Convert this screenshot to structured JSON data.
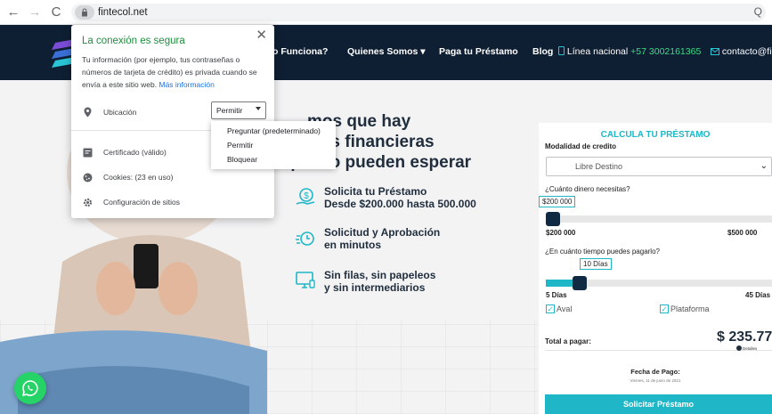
{
  "browser": {
    "url": "fintecol.net",
    "back_glyph": "←",
    "forward_glyph": "→",
    "reload_glyph": "C",
    "end_glyph": "Q"
  },
  "navbar": {
    "items": [
      {
        "label": "o Funciona?"
      },
      {
        "label": "Quienes Somos ▾"
      },
      {
        "label": "Paga tu Préstamo"
      },
      {
        "label": "Blog"
      }
    ],
    "line_label": "Línea nacional",
    "phone": "+57 3002161365",
    "email": "contacto@fi"
  },
  "hero": {
    "headline_line1": "mos que hay",
    "headline_line2": "cias financieras",
    "headline_line3": "que no pueden esperar",
    "features": [
      {
        "icon": "money-request-icon",
        "line1": "Solicita tu Préstamo",
        "line2": "Desde $200.000 hasta 500.000"
      },
      {
        "icon": "stopwatch-icon",
        "line1": "Solicitud y Aprobación",
        "line2": "en minutos"
      },
      {
        "icon": "monitor-icon",
        "line1": "Sin filas, sin papeleos",
        "line2": "y sin intermediarios"
      }
    ]
  },
  "calculator": {
    "title": "CALCULA TU PRÉSTAMO",
    "modalidad_label": "Modalidad de credito",
    "modalidad_value": "Libre Destino",
    "amount_question": "¿Cuánto dinero necesitas?",
    "amount_value": "$200 000",
    "amount_min": "$200 000",
    "amount_max": "$500 000",
    "amount_fraction": 0.0,
    "time_question": "¿En cuánto tiempo puedes pagarlo?",
    "time_value": "10 Días",
    "time_min": "5 Días",
    "time_max": "45 Días",
    "time_fraction": 0.125,
    "aval_label": "Aval",
    "plataforma_label": "Plataforma",
    "total_label": "Total a pagar:",
    "total_value": "$ 235.77",
    "detalles_label": "Detalles",
    "fecha_label": "Fecha de Pago:",
    "fecha_value": "Viernes, 11 de junio de 2021",
    "cta_label": "Solicitar Préstamo"
  },
  "popup": {
    "title": "La conexión es segura",
    "description": "Tu información (por ejemplo, tus contraseñas o números de tarjeta de crédito) es privada cuando se envía a este sitio web.",
    "link": "Más información",
    "location_label": "Ubicación",
    "permission_value": "Permitir",
    "certificate_label": "Certificado (válido)",
    "cookies_label": "Cookies: (23 en uso)",
    "settings_label": "Configuración de sitios"
  },
  "dropdown": {
    "options": [
      {
        "label": "Preguntar (predeterminado)"
      },
      {
        "label": "Permitir"
      },
      {
        "label": "Bloquear"
      }
    ]
  },
  "colors": {
    "navbar_bg": "#0f1f33",
    "accent": "#1fb7c7",
    "secure_green": "#1e8e3e",
    "whatsapp": "#25d366"
  }
}
